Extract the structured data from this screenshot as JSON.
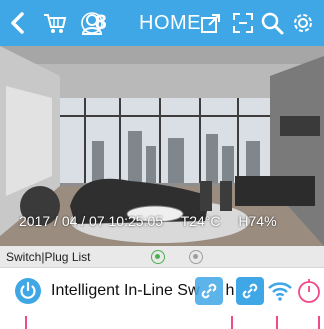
{
  "header": {
    "title": "HOME",
    "user_count": "8",
    "icons": [
      "chevron-left-icon",
      "cart-icon",
      "user-icon",
      "share-icon",
      "fullscreen-icon",
      "search-icon",
      "gear-icon"
    ]
  },
  "camera": {
    "datetime": "2017 / 04 / 07 10:25:05",
    "temperature": "T24°C",
    "humidity": "H74%"
  },
  "switch_list": {
    "label": "Switch|Plug List"
  },
  "device": {
    "name": "Intelligent In-Line Sw",
    "name_tail": "h 1",
    "icons": [
      "power-icon",
      "link-icon",
      "link-icon",
      "wifi-icon",
      "timer-icon"
    ]
  },
  "colors": {
    "accent": "#3fa7e6",
    "active_dot": "#4caf50",
    "marker": "#ef4a8a"
  }
}
